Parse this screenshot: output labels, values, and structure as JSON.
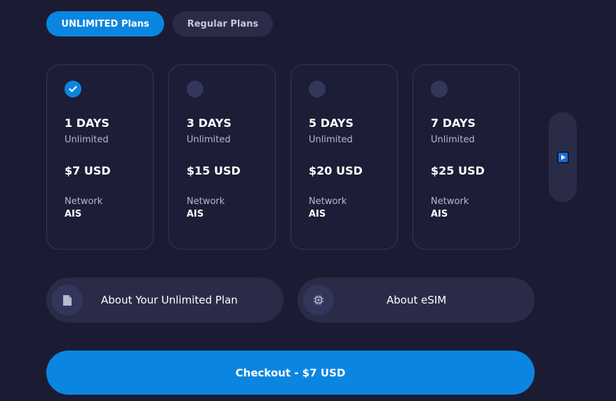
{
  "tabs": {
    "unlimited": "UNLIMITED Plans",
    "regular": "Regular Plans"
  },
  "plans": [
    {
      "days": "1 DAYS",
      "type": "Unlimited",
      "price": "$7 USD",
      "network_label": "Network",
      "network": "AIS",
      "selected": true
    },
    {
      "days": "3 DAYS",
      "type": "Unlimited",
      "price": "$15 USD",
      "network_label": "Network",
      "network": "AIS",
      "selected": false
    },
    {
      "days": "5 DAYS",
      "type": "Unlimited",
      "price": "$20 USD",
      "network_label": "Network",
      "network": "AIS",
      "selected": false
    },
    {
      "days": "7 DAYS",
      "type": "Unlimited",
      "price": "$25 USD",
      "network_label": "Network",
      "network": "AIS",
      "selected": false
    }
  ],
  "info": {
    "plan_label": "About Your Unlimited Plan",
    "esim_label": "About eSIM"
  },
  "checkout_label": "Checkout - $7 USD",
  "icons": {
    "check": "check-icon",
    "next": "play-icon",
    "document": "document-icon",
    "chip": "chip-icon"
  },
  "colors": {
    "background": "#1b1c34",
    "accent": "#0a86e0",
    "card_border": "#34365a",
    "pill": "#2a2c47"
  }
}
